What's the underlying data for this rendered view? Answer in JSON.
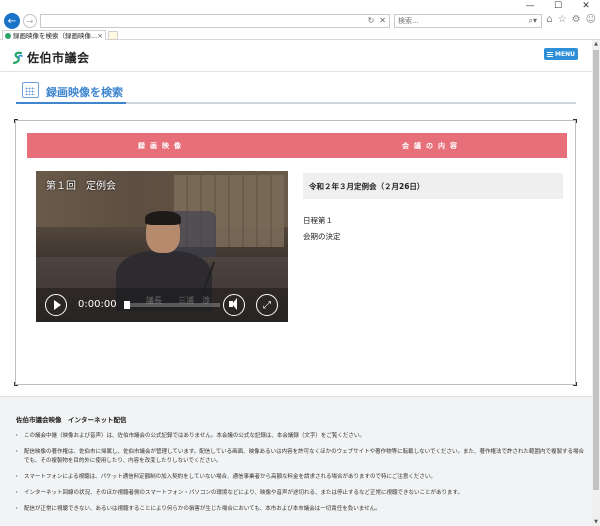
{
  "browser": {
    "window_controls": [
      "—",
      "☐",
      "✕"
    ],
    "address_value": "",
    "address_icons": [
      "↻",
      "✕"
    ],
    "search_placeholder": "検索...",
    "search_icon": "search-icon",
    "toolbar_icons": [
      "home-icon",
      "star-icon",
      "gear-icon",
      "smiley-icon"
    ],
    "tab_label": "録画映像を検索（録画映像...",
    "tab_close": "×"
  },
  "site": {
    "logo_text": "佐伯市議会",
    "menu_label": "MENU",
    "accent_color": "#3f86cf",
    "menu_color": "#2e8fd8"
  },
  "page": {
    "heading": "録画映像を検索"
  },
  "table": {
    "header_video": "録画映像",
    "header_content": "会議の内容",
    "header_color": "#e76f7a"
  },
  "video": {
    "caption": "第１回　定例会",
    "lower_third": "議長　　三浦　渉",
    "time": "0:00:00",
    "progress": 0
  },
  "meeting": {
    "session_title": "令和２年３月定例会（２月26日）",
    "agenda": [
      "日程第１",
      "会期の決定"
    ]
  },
  "notes": {
    "title": "佐伯市議会映像　インターネット配信",
    "items": [
      "この議会中継（映像および音声）は、佐伯市議会の公式記録ではありません。本会議の公式な記録は、本会議録（文字）をご覧ください。",
      "配信映像の著作権は、佐伯市に帰属し、佐伯市議会が管理しています。配信している画面、映像あるいは内容を許可なくほかのウェブサイトや著作物等に転載しないでください。また、著作権法で許された範囲内で複製する場合でも、その複製物を目的外に使用したり、内容を改変したりしないでください。",
      "スマートフォンによる視聴は、パケット通信料定額制の加入契約をしていない場合、通信事業者から高額な料金を請求される場合がありますので特にご注意ください。",
      "インターネット回線の状況、そのほか視聴者側のスマートフォン・パソコンの環境などにより、映像や音声が途切れる、または停止するなど正常に視聴できないことがあります。",
      "配信が正常に視聴できない、あるいは視聴することにより何らかの損害が生じた場合においても、本市および本市議会は一切責任を負いません。"
    ]
  }
}
